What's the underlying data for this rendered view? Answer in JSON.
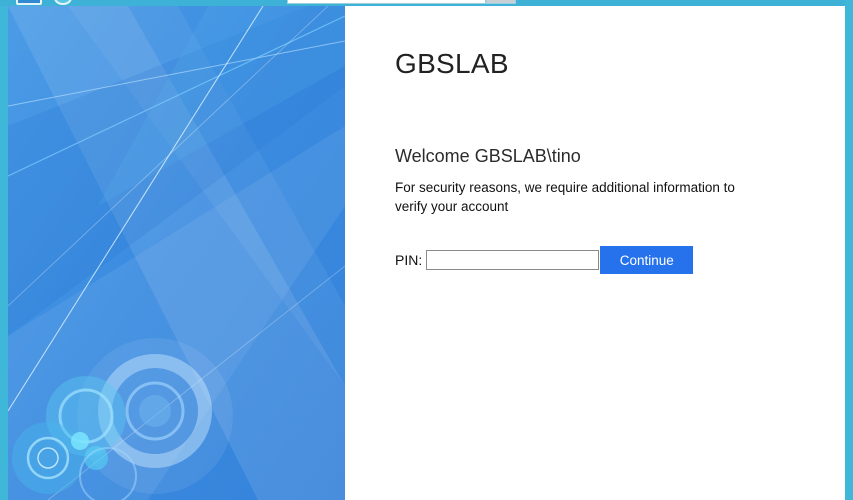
{
  "window": {
    "accent_color": "#3fb7d9"
  },
  "branding": {
    "organization_name": "GBSLAB",
    "panel_color": "#3c8de0"
  },
  "main": {
    "welcome_text": "Welcome GBSLAB\\tino",
    "description": "For security reasons, we require additional information to verify your account",
    "pin_label": "PIN:",
    "pin_value": "",
    "continue_label": "Continue",
    "button_color": "#2672ec"
  }
}
